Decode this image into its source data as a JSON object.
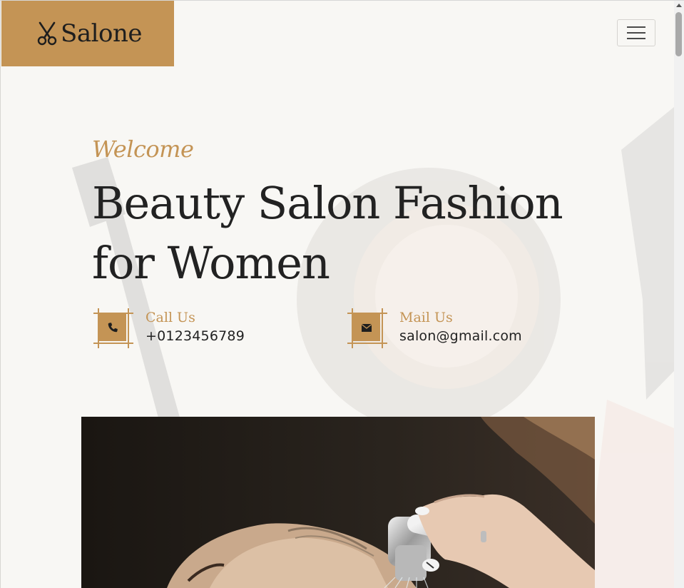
{
  "brand": {
    "name": "Salone",
    "icon": "scissors-icon",
    "color": "#c49455"
  },
  "nav": {
    "toggler_icon": "hamburger-icon"
  },
  "hero": {
    "welcome": "Welcome",
    "title": "Beauty Salon Fashion for Women"
  },
  "contacts": [
    {
      "label": "Call Us",
      "value": "+0123456789",
      "icon": "phone-icon"
    },
    {
      "label": "Mail Us",
      "value": "salon@gmail.com",
      "icon": "envelope-icon"
    }
  ],
  "colors": {
    "accent": "#c49455",
    "text": "#222222",
    "background": "#f8f7f4"
  }
}
